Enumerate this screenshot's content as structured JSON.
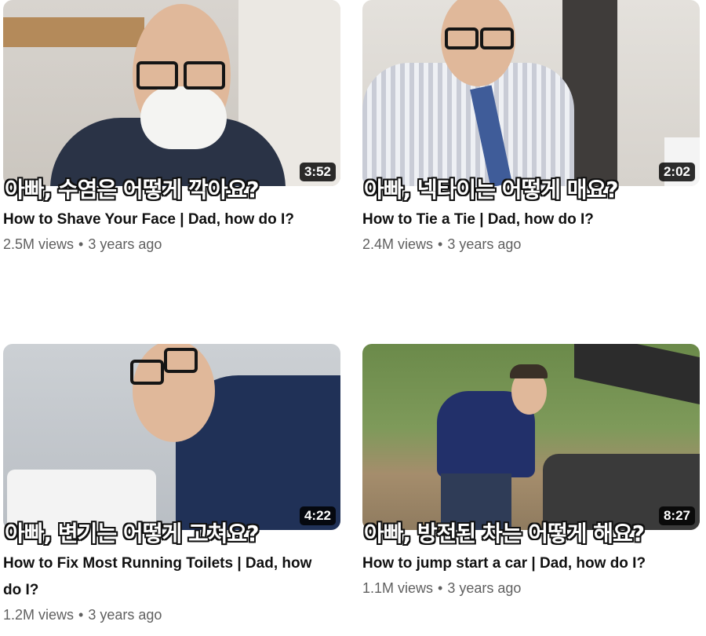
{
  "videos": [
    {
      "duration": "3:52",
      "caption": "아빠, 수염은 어떻게 깍아요?",
      "title": "How to Shave Your Face | Dad, how do I?",
      "views": "2.5M views",
      "age": "3 years ago"
    },
    {
      "duration": "2:02",
      "caption": "아빠, 넥타이는 어떻게 매요?",
      "title": "How to Tie a Tie | Dad, how do I?",
      "views": "2.4M views",
      "age": "3 years ago"
    },
    {
      "duration": "4:22",
      "caption": "아빠, 변기는 어떻게 고쳐요?",
      "title": "How to Fix Most Running Toilets | Dad, how do I?",
      "views": "1.2M views",
      "age": "3 years ago"
    },
    {
      "duration": "8:27",
      "caption": "아빠, 방전된 차는 어떻게 해요?",
      "title": "How to jump start a car | Dad, how do I?",
      "views": "1.1M views",
      "age": "3 years ago"
    }
  ],
  "separator": "•"
}
